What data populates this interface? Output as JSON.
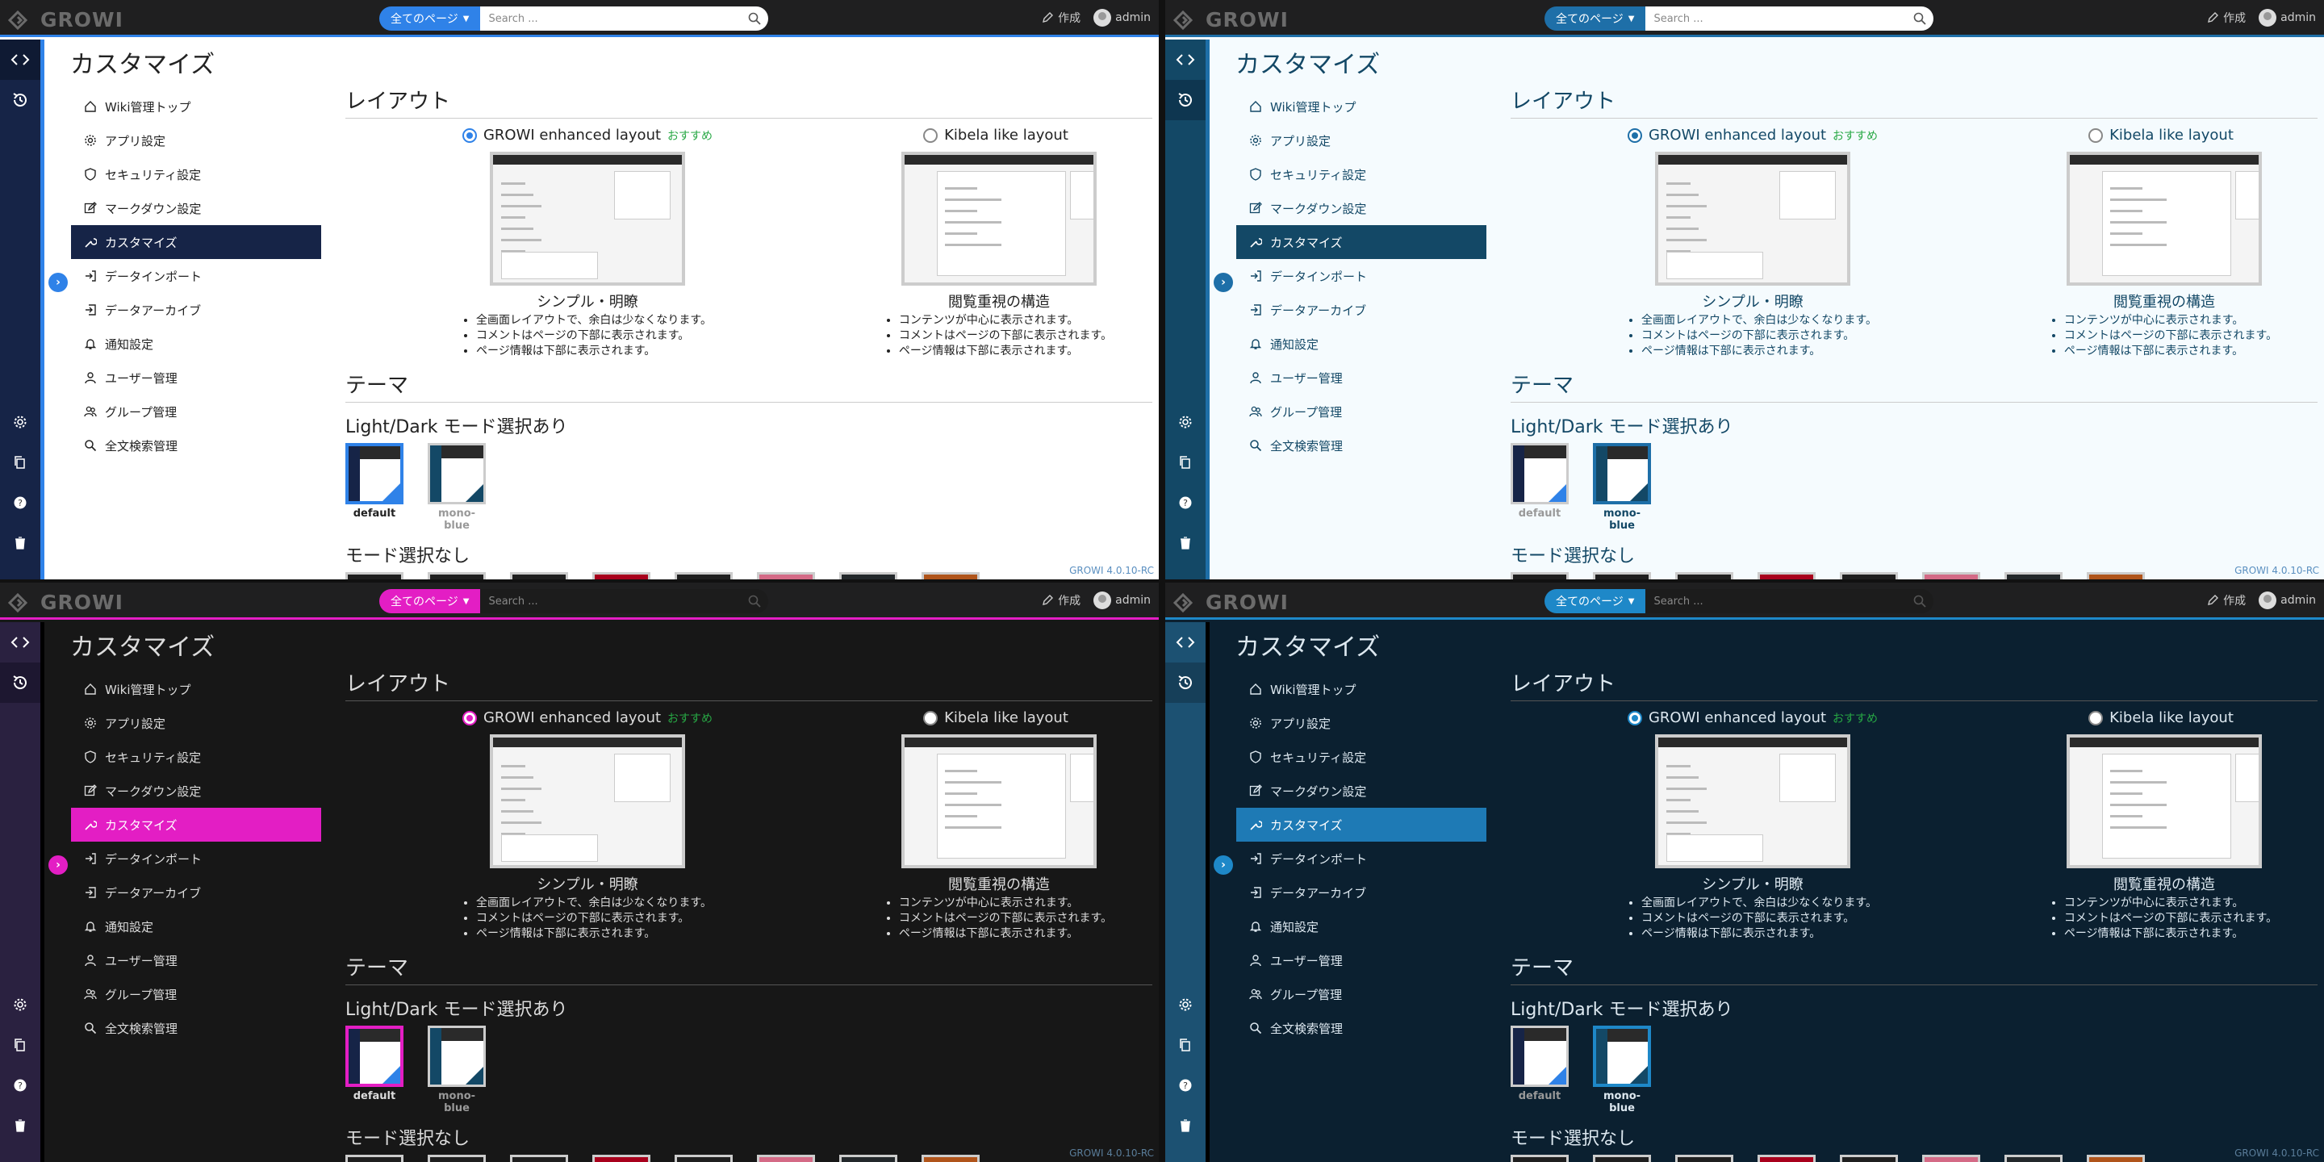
{
  "shared": {
    "app_name": "GROWI",
    "search": {
      "scope_label": "全てのページ",
      "placeholder": "Search ..."
    },
    "create_label": "作成",
    "user_label": "admin",
    "page_title": "カスタマイズ",
    "menu": [
      {
        "label": "Wiki管理トップ",
        "icon": "home-icon"
      },
      {
        "label": "アプリ設定",
        "icon": "gear-icon"
      },
      {
        "label": "セキュリティ設定",
        "icon": "shield-icon"
      },
      {
        "label": "マークダウン設定",
        "icon": "edit-icon"
      },
      {
        "label": "カスタマイズ",
        "icon": "wrench-icon"
      },
      {
        "label": "データインポート",
        "icon": "import-icon"
      },
      {
        "label": "データアーカイブ",
        "icon": "archive-icon"
      },
      {
        "label": "通知設定",
        "icon": "bell-icon"
      },
      {
        "label": "ユーザー管理",
        "icon": "user-icon"
      },
      {
        "label": "グループ管理",
        "icon": "group-icon"
      },
      {
        "label": "全文検索管理",
        "icon": "search-icon"
      }
    ],
    "layout_section": "レイアウト",
    "layouts": [
      {
        "name": "GROWI enhanced layout",
        "badge": "おすすめ",
        "selected": true,
        "caption": "シンプル・明瞭",
        "bullets": [
          "全画面レイアウトで、余白は少なくなります。",
          "コメントはページの下部に表示されます。",
          "ページ情報は下部に表示されます。"
        ]
      },
      {
        "name": "Kibela like layout",
        "badge": "",
        "selected": false,
        "caption": "閲覧重視の構造",
        "bullets": [
          "コンテンツが中心に表示されます。",
          "コメントはページの下部に表示されます。",
          "ページ情報は下部に表示されます。"
        ]
      }
    ],
    "theme_section": "テーマ",
    "light_dark_label": "Light/Dark モード選択あり",
    "no_mode_label": "モード選択なし",
    "themes": [
      {
        "name": "default"
      },
      {
        "name": "mono-blue"
      }
    ],
    "no_mode_swatches": [
      {
        "top": "#1f1f1f",
        "side": "#1c4a36",
        "body": "#e8f0ec"
      },
      {
        "top": "#1f1f1f",
        "side": "#9a8c4a",
        "body": "#f7f7f2"
      },
      {
        "top": "#1f1f1f",
        "side": "#24343c",
        "body": "#c9f0ee"
      },
      {
        "top": "#a8001c",
        "side": "#2a8a3a",
        "body": "#ffffff"
      },
      {
        "top": "#1f1f1f",
        "side": "#0a0a78",
        "body": "#f0f0f0"
      },
      {
        "top": "#d46a86",
        "side": "#f1c4cf",
        "body": "#fbe8ee"
      },
      {
        "top": "#23282b",
        "side": "#19b5c4",
        "body": "#23282b"
      },
      {
        "top": "#b0541a",
        "side": "#111111",
        "body": "#111111"
      }
    ],
    "footer": "GROWI 4.0.10-RC"
  },
  "panels": [
    {
      "key": "tl",
      "scheme": "default-light",
      "accent": "#2f82e8",
      "active_bg": "#162447",
      "nav_bg": "#162447",
      "nav_active": "#0f1a33",
      "bg": "#ffffff",
      "text": "#222222",
      "theme_selected": 0,
      "dark": false
    },
    {
      "key": "tr",
      "scheme": "mono-blue-light",
      "accent": "#1e6fa8",
      "active_bg": "#134866",
      "nav_bg": "#134866",
      "nav_active": "#0e3650",
      "bg": "#f5fbfe",
      "text": "#134866",
      "theme_selected": 1,
      "dark": false
    },
    {
      "key": "bl",
      "scheme": "default-dark",
      "accent": "#e31ec4",
      "active_bg": "#e31ec4",
      "nav_bg": "#2a2140",
      "nav_active": "#1d1730",
      "bg": "#171717",
      "text": "#dcdcdc",
      "theme_selected": 0,
      "dark": true
    },
    {
      "key": "br",
      "scheme": "mono-blue-dark",
      "accent": "#1e88c8",
      "active_bg": "#1e7ab5",
      "nav_bg": "#1c5172",
      "nav_active": "#163f59",
      "bg": "#0b2030",
      "text": "#dde8f0",
      "theme_selected": 1,
      "dark": true
    }
  ]
}
